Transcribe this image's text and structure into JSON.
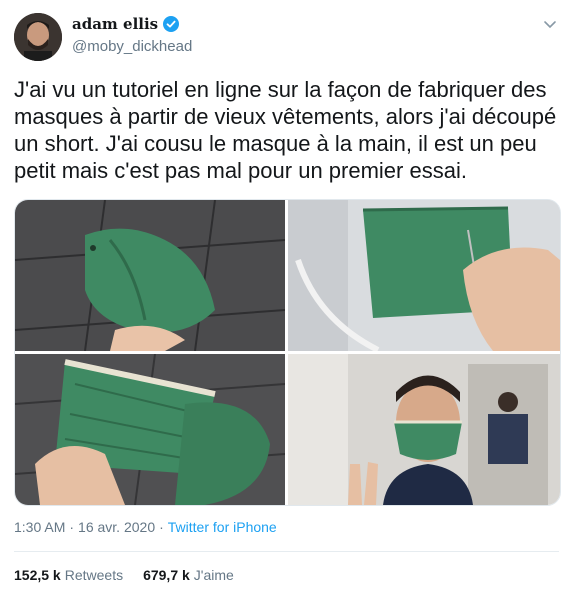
{
  "author": {
    "display_name": "adam ellis",
    "handle": "@moby_dickhead",
    "verified": true
  },
  "tweet": {
    "text": "J'ai vu un tutoriel en ligne sur la façon de fabriquer des masques à partir de vieux vêtements, alors j'ai découpé un short. J'ai cousu le masque à la main, il est un peu petit mais c'est pas mal pour un premier essai."
  },
  "media": [
    {
      "subject": "green shorts on tiled floor"
    },
    {
      "subject": "hand sewing green fabric mask"
    },
    {
      "subject": "finished mask next to cut shorts"
    },
    {
      "subject": "man wearing green mask in bathroom mirror"
    }
  ],
  "meta": {
    "time": "1:30 AM",
    "separator": "·",
    "date": "16 avr. 2020",
    "separator2": "·",
    "source": "Twitter for iPhone"
  },
  "stats": {
    "retweets_count": "152,5 k",
    "retweets_label": "Retweets",
    "likes_count": "679,7 k",
    "likes_label": "J'aime"
  },
  "colors": {
    "link": "#1da1f2",
    "muted": "#657786",
    "text": "#14171a",
    "mask_green": "#3f8a63"
  },
  "icons": [
    "verified-badge-icon",
    "chevron-down-icon"
  ]
}
